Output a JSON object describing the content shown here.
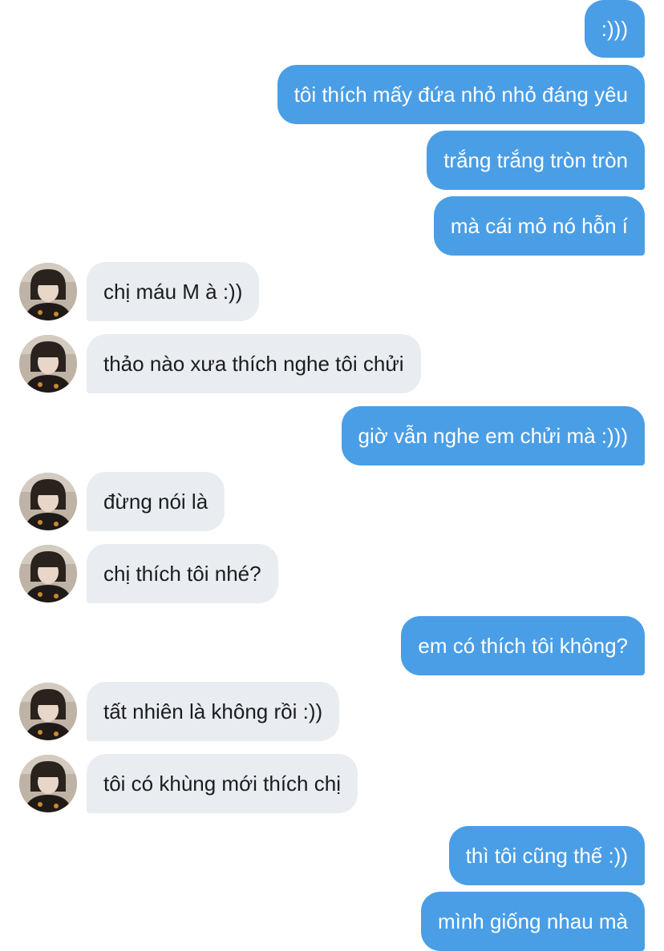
{
  "colors": {
    "sent_bubble": "#4a9ee6",
    "received_bubble": "#e9ecf0",
    "sent_text": "#ffffff",
    "received_text": "#1c1c1e"
  },
  "avatar_icon": "contact-avatar-photo",
  "messages": [
    {
      "sender": "me",
      "text": ":)))"
    },
    {
      "sender": "me",
      "text": "tôi thích mấy đứa nhỏ nhỏ đáng yêu"
    },
    {
      "sender": "me",
      "text": "trắng trắng tròn tròn"
    },
    {
      "sender": "me",
      "text": "mà cái mỏ nó hỗn í"
    },
    {
      "sender": "them",
      "text": "chị máu M à :))"
    },
    {
      "sender": "them",
      "text": "thảo nào xưa thích nghe tôi chửi"
    },
    {
      "sender": "me",
      "text": "giờ vẫn nghe em chửi mà :)))"
    },
    {
      "sender": "them",
      "text": "đừng nói là"
    },
    {
      "sender": "them",
      "text": "chị thích tôi nhé?"
    },
    {
      "sender": "me",
      "text": "em có thích tôi không?"
    },
    {
      "sender": "them",
      "text": "tất nhiên là không rồi :))"
    },
    {
      "sender": "them",
      "text": "tôi có khùng mới thích chị"
    },
    {
      "sender": "me",
      "text": "thì tôi cũng thế :))"
    },
    {
      "sender": "me",
      "text": "mình giống nhau mà"
    }
  ]
}
